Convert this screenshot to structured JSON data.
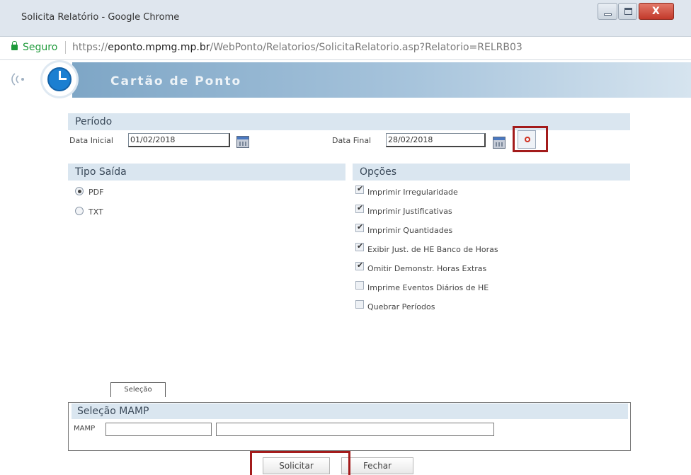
{
  "window": {
    "title": "Solicita Relatório - Google Chrome",
    "close_label": "X"
  },
  "address": {
    "secure_label": "Seguro",
    "url_protocol": "https://",
    "url_host": "eponto.mpmg.mp.br",
    "url_path": "/WebPonto/Relatorios/SolicitaRelatorio.asp?Relatorio=RELRB03"
  },
  "header": {
    "title": "Cartão de Ponto"
  },
  "periodo": {
    "section_title": "Período",
    "data_inicial_label": "Data Inicial",
    "data_inicial_value": "01/02/2018",
    "data_final_label": "Data Final",
    "data_final_value": "28/02/2018"
  },
  "tipo_saida": {
    "section_title": "Tipo Saída",
    "options": [
      {
        "label": "PDF",
        "checked": true
      },
      {
        "label": "TXT",
        "checked": false
      }
    ]
  },
  "opcoes": {
    "section_title": "Opções",
    "items": [
      {
        "label": "Imprimir Irregularidade",
        "checked": true
      },
      {
        "label": "Imprimir Justificativas",
        "checked": true
      },
      {
        "label": "Imprimir Quantidades",
        "checked": true
      },
      {
        "label": "Exibir Just. de HE Banco de Horas",
        "checked": true
      },
      {
        "label": "Omitir Demonstr. Horas Extras",
        "checked": true
      },
      {
        "label": "Imprime Eventos Diários de HE",
        "checked": false
      },
      {
        "label": "Quebrar Períodos",
        "checked": false
      }
    ]
  },
  "selecao": {
    "tab_label": "Seleção",
    "section_title": "Seleção MAMP",
    "mamp_label": "MAMP"
  },
  "buttons": {
    "solicitar": "Solicitar",
    "fechar": "Fechar"
  },
  "colors": {
    "highlight": "#a31b1b",
    "secure_green": "#1e9a3a",
    "section_bg": "#dae6f0"
  }
}
